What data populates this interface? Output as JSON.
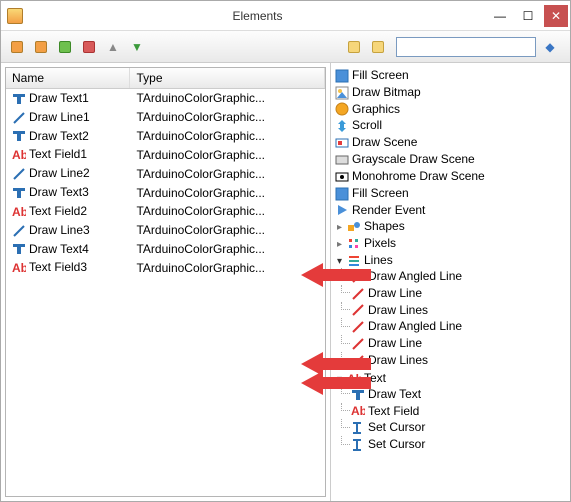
{
  "window": {
    "title": "Elements"
  },
  "toolbar": {
    "left": [
      {
        "name": "add-box-icon"
      },
      {
        "name": "add-box-green-icon"
      },
      {
        "name": "box-green-icon"
      },
      {
        "name": "box-red-icon"
      },
      {
        "name": "arrow-up-icon"
      },
      {
        "name": "arrow-down-icon"
      }
    ],
    "right": [
      {
        "name": "paste1-icon"
      },
      {
        "name": "paste2-icon"
      }
    ],
    "search_placeholder": ""
  },
  "grid": {
    "columns": {
      "name": "Name",
      "type": "Type"
    },
    "rows": [
      {
        "icon": "text-icon",
        "name": "Draw Text1",
        "type": "TArduinoColorGraphic..."
      },
      {
        "icon": "line-icon",
        "name": "Draw Line1",
        "type": "TArduinoColorGraphic..."
      },
      {
        "icon": "text-icon",
        "name": "Draw Text2",
        "type": "TArduinoColorGraphic..."
      },
      {
        "icon": "field-icon",
        "name": "Text Field1",
        "type": "TArduinoColorGraphic..."
      },
      {
        "icon": "line-icon",
        "name": "Draw Line2",
        "type": "TArduinoColorGraphic..."
      },
      {
        "icon": "text-icon",
        "name": "Draw Text3",
        "type": "TArduinoColorGraphic..."
      },
      {
        "icon": "field-icon",
        "name": "Text Field2",
        "type": "TArduinoColorGraphic..."
      },
      {
        "icon": "line-icon",
        "name": "Draw Line3",
        "type": "TArduinoColorGraphic..."
      },
      {
        "icon": "text-icon",
        "name": "Draw Text4",
        "type": "TArduinoColorGraphic..."
      },
      {
        "icon": "field-icon",
        "name": "Text Field3",
        "type": "TArduinoColorGraphic..."
      }
    ]
  },
  "tree": {
    "top": [
      {
        "icon": "fill-icon",
        "label": "Fill Screen"
      },
      {
        "icon": "bitmap-icon",
        "label": "Draw Bitmap"
      },
      {
        "icon": "graphics-icon",
        "label": "Graphics"
      },
      {
        "icon": "scroll-icon",
        "label": "Scroll"
      },
      {
        "icon": "scene-icon",
        "label": "Draw Scene"
      },
      {
        "icon": "gray-scene-icon",
        "label": "Grayscale Draw Scene"
      },
      {
        "icon": "mono-scene-icon",
        "label": "Monohrome Draw Scene"
      },
      {
        "icon": "fill-icon",
        "label": "Fill Screen"
      },
      {
        "icon": "render-icon",
        "label": "Render Event"
      }
    ],
    "shapes": {
      "label": "Shapes"
    },
    "pixels": {
      "label": "Pixels"
    },
    "lines": {
      "label": "Lines",
      "children": [
        {
          "label": "Draw Angled Line"
        },
        {
          "label": "Draw Line"
        },
        {
          "label": "Draw Lines"
        },
        {
          "label": "Draw Angled Line"
        },
        {
          "label": "Draw Line"
        },
        {
          "label": "Draw Lines"
        }
      ]
    },
    "text": {
      "label": "Text",
      "children": [
        {
          "icon": "text-icon",
          "label": "Draw Text"
        },
        {
          "icon": "field-icon",
          "label": "Text Field"
        },
        {
          "icon": "cursor-icon",
          "label": "Set Cursor"
        },
        {
          "icon": "cursor-icon",
          "label": "Set Cursor"
        }
      ]
    }
  }
}
